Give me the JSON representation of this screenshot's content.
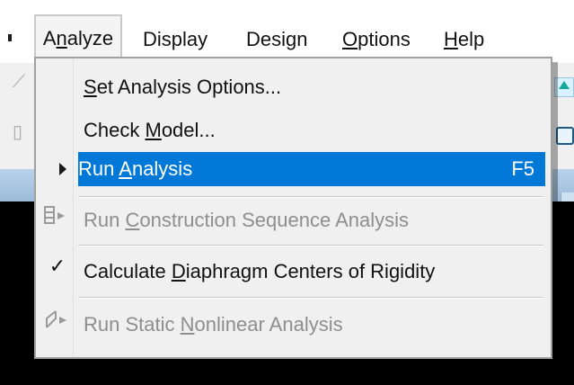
{
  "menubar": {
    "items": [
      {
        "label_pre": "",
        "label_u": "",
        "label_post": "Analyze",
        "label": "Analyze"
      },
      {
        "label": "Display"
      },
      {
        "label": "Design"
      },
      {
        "label_pre": "",
        "label_u": "O",
        "label_post": "ptions",
        "label": "Options"
      },
      {
        "label_pre": "",
        "label_u": "H",
        "label_post": "elp",
        "label": "Help"
      }
    ],
    "analyze": {
      "pre": "A",
      "u": "n",
      "post": "alyze"
    }
  },
  "dropdown": {
    "items": [
      {
        "pre": "",
        "u": "S",
        "post": "et Analysis Options...",
        "label": "Set Analysis Options...",
        "enabled": true
      },
      {
        "pre": "Check ",
        "u": "M",
        "post": "odel...",
        "label": "Check Model...",
        "enabled": true
      },
      {
        "pre": "Run ",
        "u": "A",
        "post": "nalysis",
        "label": "Run Analysis",
        "shortcut": "F5",
        "enabled": true,
        "highlighted": true
      },
      {
        "pre": "Run ",
        "u": "C",
        "post": "onstruction Sequence Analysis",
        "label": "Run Construction Sequence Analysis",
        "enabled": false
      },
      {
        "pre": "Calculate ",
        "u": "D",
        "post": "iaphragm Centers of Rigidity",
        "label": "Calculate Diaphragm Centers of Rigidity",
        "enabled": true,
        "checked": true
      },
      {
        "pre": "Run Static ",
        "u": "N",
        "post": "onlinear Analysis",
        "label": "Run Static Nonlinear Analysis",
        "enabled": false
      }
    ]
  },
  "icons": {
    "submenu_arrow": "submenu-arrow-icon",
    "check": "checkmark-icon",
    "sequence": "construction-sequence-icon",
    "pushover": "static-nonlinear-icon"
  },
  "colors": {
    "highlight": "#0078d7",
    "menu_bg": "#f0f0f0",
    "disabled_text": "#8e8e8e",
    "background_viewport": "#000000"
  }
}
